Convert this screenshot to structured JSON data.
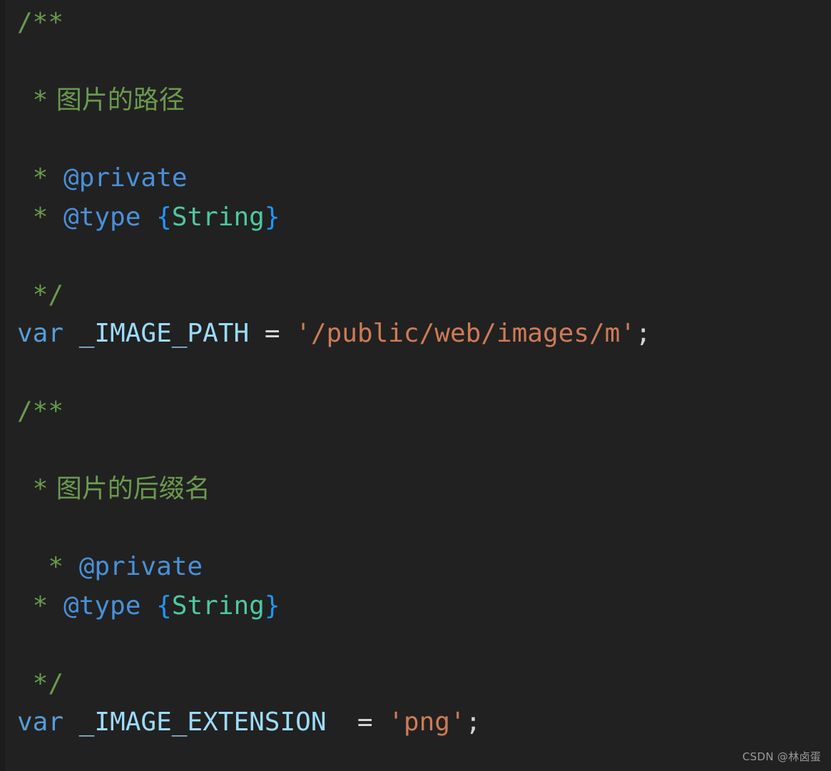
{
  "editor": {
    "background_color": "#212121",
    "language": "javascript"
  },
  "theme": {
    "comment": "#6a9a4f",
    "doc_tag": "#4a90d9",
    "brace": "#2196f3",
    "type_name": "#4ec9a0",
    "keyword": "#569cd6",
    "identifier": "#9cdcfe",
    "string": "#ce7b56",
    "punctuation": "#d4d4d4",
    "background": "#212121"
  },
  "code": {
    "block1": {
      "open": "/**",
      "description_star": " *",
      "description_text": " 图片的路径",
      "private_star": " *",
      "private_tag": " @private",
      "type_star": " *",
      "type_tag": " @type ",
      "type_brace_open": "{",
      "type_name": "String",
      "type_brace_close": "}",
      "close": " */",
      "decl_keyword": "var",
      "decl_space1": " ",
      "decl_identifier": "_IMAGE_PATH",
      "decl_space2": " ",
      "decl_equals": "=",
      "decl_space3": " ",
      "decl_value": "'/public/web/images/m'",
      "decl_semicolon": ";"
    },
    "block2": {
      "open": "/**",
      "description_star": " *",
      "description_text": " 图片的后缀名",
      "private_star": "  *",
      "private_tag": " @private",
      "type_star": " *",
      "type_tag": " @type ",
      "type_brace_open": "{",
      "type_name": "String",
      "type_brace_close": "}",
      "close": " */",
      "decl_keyword": "var",
      "decl_space1": " ",
      "decl_identifier": "_IMAGE_EXTENSION",
      "decl_space2": "  ",
      "decl_equals": "=",
      "decl_space3": " ",
      "decl_value": "'png'",
      "decl_semicolon": ";"
    }
  },
  "watermark": {
    "text": "CSDN @林卤蛋"
  }
}
